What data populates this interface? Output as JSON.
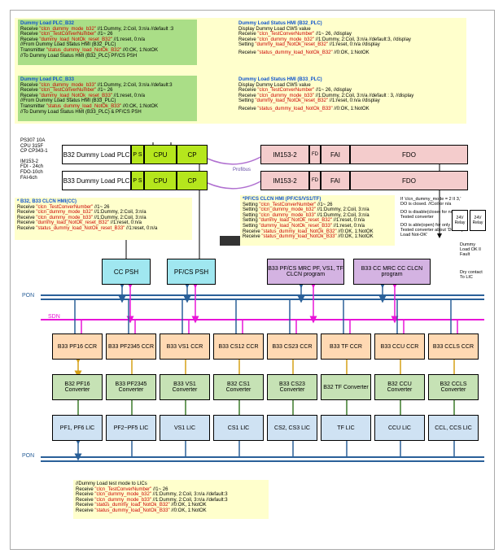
{
  "b32plc": {
    "title": "Dummy Load PLC_B32",
    "l1": "Receive ",
    "r1": "\"clcn_dummy_mode_b32\"",
    "s1": " //1:Dummy, 2:Coil, 3:n/a  //default :3",
    "l2": "Receive ",
    "r2": "\"clcn_TestConverNumber\"",
    "s2": " //1~ 26",
    "l3": "Receive ",
    "r3": "\"dummy_load_NotOk_reset_B32\"",
    "s3": " //1:reset, 0:n/a",
    "l4": "//From Dummy Load Status HMI (B32_PLC)",
    "l5": "Transmitter ",
    "r5": "\"status_dummy_load_NotOk_B32\"",
    "s5": " //0:OK, 1:NotOK",
    "l6": "//To Dummy Load Status HMI (B32_PLC) PF/CS PSH"
  },
  "b33plc": {
    "title": "Dummy Load PLC_B33",
    "l1": "Receive ",
    "r1": "\"clcn_dummy_mode_b33\"",
    "s1": " //1:Dummy, 2:Coil, 3:n/a  //default:3",
    "l2": "Receive ",
    "r2": "\"clcn_TestConverNumber\"",
    "s2": " //1~ 26",
    "l3": "Receive ",
    "r3": "\"dummy_load_NotOk_reset_B33\"",
    "s3": " //1:reset, 0:n/a",
    "l4": "//From Dummy Load Status HMI (B33_PLC)",
    "l5": "Transmitter ",
    "r5": "\"status_dummy_load_NotOk_B33\"",
    "s5": " //0:OK, 1:NotOK",
    "l6": "//To Dummy Load Status HMI (B33_PLC) & PF/CS PSH"
  },
  "b32hmi": {
    "title": "Dummy Load Status HMI (B32_PLC)",
    "d": "Display Dummy Load CWS value",
    "l1": "Receive ",
    "r1": "\"clcn_TestConverNumber\"",
    "s1": " //1~ 26,  //display",
    "l2": "Receive ",
    "r2": "\"clcn_dummy_mode_b32\"",
    "s2": " //1:Dummy, 2:Coil, 3:n/a  //default:3,  //display",
    "l3": "Setting ",
    "r3": "\"dummy_load_NotOk_reset_B32\"",
    "s3": " //1:reset, 0:n/a  //display",
    "l4": "Receive ",
    "r4": "\"status_dummy_load_NotOk_B32\"",
    "s4": " //0:OK, 1:NotOK"
  },
  "b33hmi": {
    "title": "Dummy Load Status HMI (B33_PLC)",
    "d": "Display Dummy Load CWS value",
    "l1": "Receive ",
    "r1": "\"clcn_TestConverNumber\"",
    "s1": " //1~ 26,  //display",
    "l2": "Receive ",
    "r2": "\"clcn_dummy_mode_b33\"",
    "s2": " //1:Dummy, 2:Coil, 3:n/a  //default : 3,  //display",
    "l3": "Setting ",
    "r3": "\"dummy_load_NotOk_reset_B32\"",
    "s3": " //1:reset, 0:n/a  //display",
    "l4": "Receive ",
    "r4": "\"status_dummy_load_NotOk_B33\"",
    "s4": " //0:OK, 1:NotOK"
  },
  "leftnote": {
    "l1": "PS307 10A",
    "l2": "CPU 315F",
    "l3": "CP CP343-1",
    "l4": "IM153-2",
    "l5": "FDI - 24ch",
    "l6": "FDO-10ch",
    "l7": "FAI-6ch"
  },
  "plcrows": {
    "b32": "B32 Dummy Load PLC",
    "b33": "B33 Dummy Load PLC",
    "ps": "P S",
    "cpu": "CPU",
    "cp": "CP",
    "im": "IM153-2",
    "fd": "FD",
    "fai": "FAI",
    "fdo": "FDO"
  },
  "ccbox": {
    "title": "* B32, B33 CLCN HMI(CC)",
    "l1": "Receive ",
    "r1": "\"clcn_TestConverNumber\"",
    "s1": " //1~ 26",
    "l2": "Receive ",
    "r2": "\"clcn_dummy_mode_b32\"",
    "s2": " //1:Dummy, 2:Coil, 3:n/a",
    "l3": "Receive ",
    "r3": "\"clcn_dummy_mode_b33\"",
    "s3": " //1:Dummy, 2:Coil, 3:n/a",
    "l4": "Receive ",
    "r4": "\"dummy_load_NotOk_reset_B32\"",
    "s4": " //1:reset, 0:n/a",
    "l5": "Receive ",
    "r5": "\"status_dummy_load_NotOk_reset_B33\"",
    "s5": " //1:reset, 0:n/a"
  },
  "pfbox": {
    "title": "*PF/CS CLCN HMI (PF/CS/VS1/TF)",
    "l1": "Setting ",
    "r1": "\"clcn_TestConverNumber\"",
    "s1": " //1~ 26",
    "l2": "Setting ",
    "r2": "\"clcn_dummy_mode_b32\"",
    "s2": " //1:Dummy, 2:Coil, 3:n/a",
    "l3": "Setting ",
    "r3": "\"clcn_dummy_mode_b33\"",
    "s3": " //1:Dummy, 2:Coil, 3:n/a",
    "l4": "Setting ",
    "r4": "\"dummy_load_NotOk_reset_B32\"",
    "s4": " //1:reset, 0:n/a",
    "l5": "Setting ",
    "r5": "\"dummy_load_NotOk_reset_B33\"",
    "s5": " //1:reset, 0:n/a",
    "l6": "Receive ",
    "r6": "\"status_dummy_load_NotOk_B32\"",
    "s6": " //0:OK, 1:NotOK",
    "l7": "Receive ",
    "r7": "\"status_dummy_load_NotOk_B33\"",
    "s7": " //0:OK, 1:NotOK"
  },
  "rightnote": {
    "l1": "If 'clcn_dummy_mode = 2 II 3,'",
    "l2": "DO is closed. //Coil or n/a",
    "l3": "DO is disable(close) for not being Tested converter",
    "l4": "DO is able(open) for only being Tested converter about 'Dummy Load Not-OK'",
    "relay": "24V Relay",
    "fault": "Dummy Load OK ll Fault",
    "dry": "Dry contact To LIC"
  },
  "psh": {
    "cc": "CC PSH",
    "pf": "PF/CS PSH"
  },
  "mrc": {
    "pf": "B33 PF/CS MRC PF, VS1, TF CLCN program",
    "cc": "B33 CC MRC CC CLCN program"
  },
  "bus": {
    "pon": "PON",
    "sdn": "SDN",
    "profibus": "Profibus"
  },
  "ccr": [
    "B33 PF16 CCR",
    "B33 PF2345 CCR",
    "B33 VS1 CCR",
    "B33 CS12 CCR",
    "B33 CS23 CCR",
    "B33 TF CCR",
    "B33 CCU CCR",
    "B33 CCLS CCR"
  ],
  "conv": [
    "B32 PF16 Converter",
    "B33 PF2345 Converter",
    "B33 VS1 Converter",
    "B32 CS1 Converter",
    "B33 CS23 Converter",
    "B32 TF Converter",
    "B32 CCU Converter",
    "B32 CCLS Converter"
  ],
  "lic": [
    "PF1, PF6 LIC",
    "PF2~PF5 LIC",
    "VS1 LIC",
    "CS1 LIC",
    "CS2, CS3 LIC",
    "TF LIC",
    "CCU LIC",
    "CCL, CCS LIC"
  ],
  "licbox": {
    "title": "//Dummy Load test mode to LICs",
    "l1": "Receive ",
    "r1": "\"clcn_TestConverNumber\"",
    "s1": " //1~ 26",
    "l2": "Receive ",
    "r2": "\"clcn_dummy_mode_b32\"",
    "s2": " //1:Dummy, 2:Coil, 3:n/a  //default:3",
    "l3": "Receive ",
    "r3": "\"clcn_dummy_mode_b33\"",
    "s3": " //1:Dummy, 2:Coil, 3:n/a  //default:3",
    "l4": "Receive ",
    "r4": "\"status_dummy_load_NotOk_B32\"",
    "s4": " //0:OK, 1:NotOK",
    "l5": "Receive ",
    "r5": "\"status_dummy_load_NotOk_B33\"",
    "s5": " //0:OK, 1:NotOK"
  }
}
